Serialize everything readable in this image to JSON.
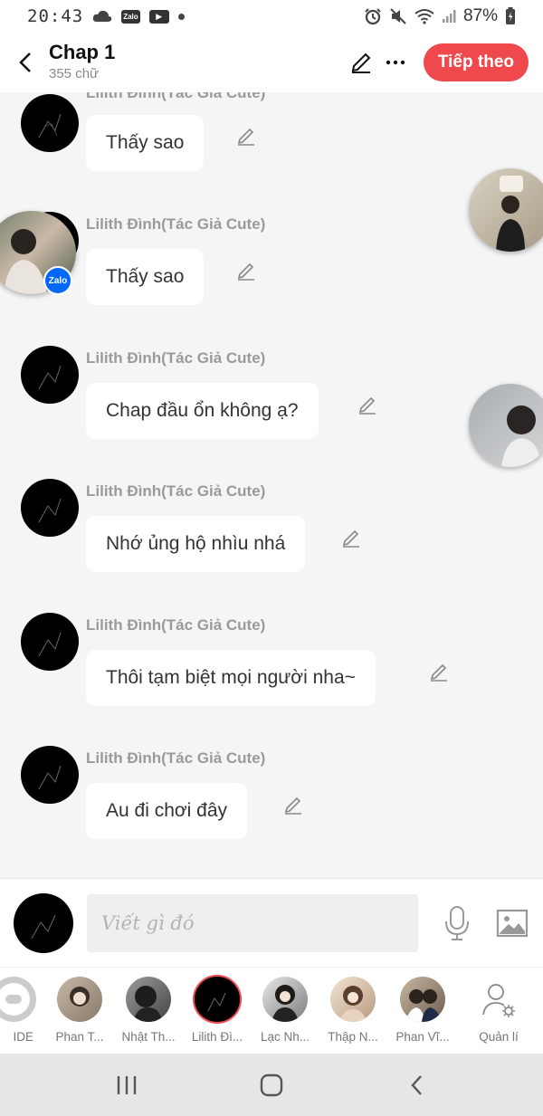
{
  "status_bar": {
    "time": "20:43",
    "battery": "87%",
    "left_icons": [
      "cloud-icon",
      "zalo-icon",
      "youtube-icon",
      "dot-icon"
    ],
    "right_icons": [
      "alarm-icon",
      "mute-icon",
      "wifi-icon",
      "signal-icon",
      "battery-icon"
    ],
    "zalo_label": "Zalo"
  },
  "header": {
    "title": "Chap 1",
    "word_count": "355 chữ",
    "next_label": "Tiếp theo",
    "accent_color": "#f0494d"
  },
  "messages": [
    {
      "author": "Lilith Đình(Tác Giả Cute)",
      "text": "Thấy sao"
    },
    {
      "author": "Lilith Đình(Tác Giả Cute)",
      "text": "Thấy sao"
    },
    {
      "author": "Lilith Đình(Tác Giả Cute)",
      "text": "Chap đầu ổn không ạ?"
    },
    {
      "author": "Lilith Đình(Tác Giả Cute)",
      "text": "Nhớ ủng hộ nhìu nhá"
    },
    {
      "author": "Lilith Đình(Tác Giả Cute)",
      "text": "Thôi tạm biệt mọi người nha~"
    },
    {
      "author": "Lilith Đình(Tác Giả Cute)",
      "text": "Au đi chơi đây"
    }
  ],
  "floating": {
    "zalo_badge": "Zalo"
  },
  "composer": {
    "placeholder": "Viết gì đó"
  },
  "characters": [
    {
      "name": "IDE"
    },
    {
      "name": "Phan T..."
    },
    {
      "name": "Nhật Th..."
    },
    {
      "name": "Lilith Đì..."
    },
    {
      "name": "Lạc Nh..."
    },
    {
      "name": "Thập N..."
    },
    {
      "name": "Phan Vĩ..."
    },
    {
      "name": "Quản lí"
    }
  ]
}
